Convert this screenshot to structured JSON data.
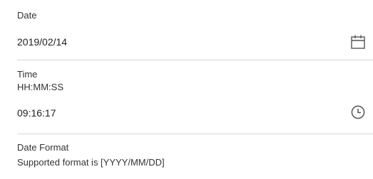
{
  "date_field": {
    "label": "Date",
    "value": "2019/02/14",
    "icon": "calendar-icon"
  },
  "time_field": {
    "label": "Time",
    "hint": "HH:MM:SS",
    "value": "09:16:17",
    "icon": "clock-icon"
  },
  "date_format": {
    "label": "Date Format",
    "value": "Supported format is [YYYY/MM/DD]"
  }
}
